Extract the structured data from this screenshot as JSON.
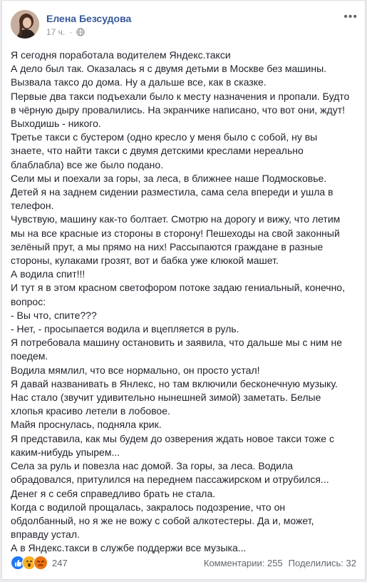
{
  "post": {
    "author": "Елена Безсудова",
    "time": "17 ч.",
    "privacy_icon": "globe-icon",
    "more_icon": "more-dots-icon",
    "lines": [
      "Я сегодня поработала водителем Яндекс.такси",
      "А дело был так. Оказалась я с двумя детьми в Москве без машины.",
      "Вызвала таксо до дома. Ну а дальше все, как в сказке.",
      "Первые два такси подъехали было к месту назначения и пропали. Будто",
      "в чёрную дыру провалились. На экранчике написано, что вот они, ждут!",
      "Выходишь - никого.",
      "Третье такси с бустером (одно кресло у меня было с собой, ну вы",
      "знаете, что найти такси с двумя детскими креслами нереально",
      "блаблабла) все же было подано.",
      "Сели мы и поехали за горы, за леса, в ближнее наше Подмосковье.",
      "Детей я на заднем сидении разместила, сама села впереди и ушла в",
      "телефон.",
      "Чувствую, машину как-то болтает. Смотрю на дорогу и вижу, что летим",
      "мы на все красные из стороны в сторону! Пешеходы на свой законный",
      "зелёный прут, а мы прямо на них! Рассыпаются граждане в разные",
      "стороны, кулаками грозят, вот и бабка уже клюкой машет.",
      "А водила спит!!!",
      "И тут я в этом красном светофором потоке задаю гениальный, конечно,",
      "вопрос:",
      "- Вы что, спите???",
      "- Нет, - просыпается водила и вцепляется в руль.",
      "Я потребовала машину остановить и заявила, что дальше мы с ним не",
      "поедем.",
      "Водила мямлил, что все нормально, он просто устал!",
      "Я давай названивать в Янлекс, но там включили бесконечную музыку.",
      "Нас стало (звучит удивительно нынешней зимой) заметать. Белые",
      "хлопья красиво летели в лобовое.",
      "Майя проснулась, подняла крик.",
      "Я представила, как мы будем до озверения ждать новое такси тоже с",
      "каким-нибудь упырем...",
      "Села за руль и повезла нас домой. За горы, за леса. Водила",
      "обрадовался, притулился на переднем пассажирском и отрубился...",
      "Денег я с себя справедливо брать не стала.",
      "Когда с водилой прощалась, закралось подозрение, что он",
      "обдолбанный, но я же не вожу с собой алкотестеры. Да и, может,",
      "вправду устал.",
      "А в Яндекс.такси в службе поддержи все музыка..."
    ]
  },
  "footer": {
    "reaction_icons": [
      "like-icon",
      "wow-icon",
      "angry-icon"
    ],
    "reaction_colors": [
      "#2078f4",
      "#f7b125",
      "#e9710f"
    ],
    "reaction_count": "247",
    "comments": "Комментарии: 255",
    "shares": "Поделились: 32"
  }
}
